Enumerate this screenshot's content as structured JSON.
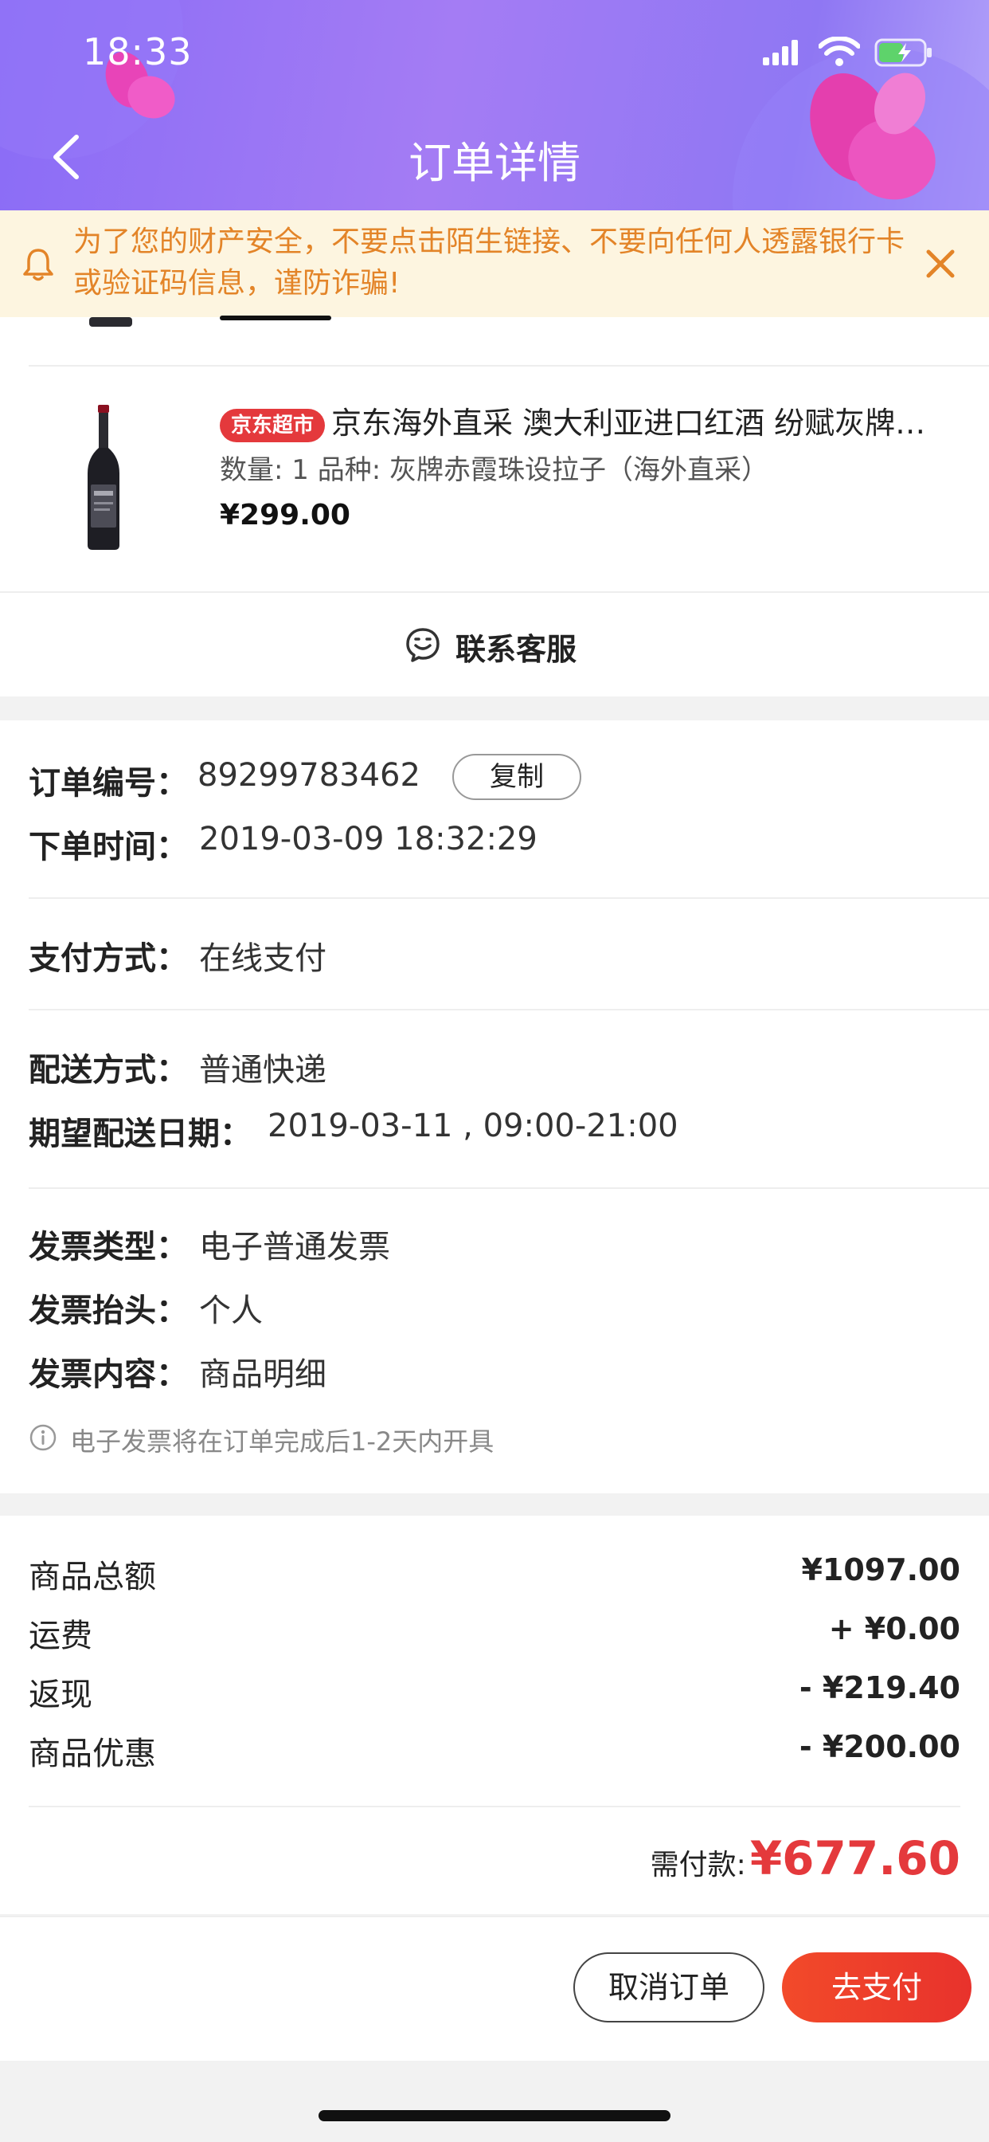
{
  "status_bar": {
    "time": "18:33"
  },
  "header": {
    "title": "订单详情"
  },
  "notice": {
    "text": "为了您的财产安全，不要点击陌生链接、不要向任何人透露银行卡或验证码信息，谨防诈骗!"
  },
  "products": [
    {
      "tag": "京东超市",
      "name": "京东海外直采 澳大利亚进口红酒 纷赋灰牌…",
      "spec": "数量: 1 品种: 灰牌赤霞珠设拉子（海外直采）",
      "price": "¥299.00"
    }
  ],
  "service": {
    "label": "联系客服"
  },
  "order": {
    "number_label": "订单编号：",
    "number": "89299783462",
    "copy_label": "复制",
    "time_label": "下单时间：",
    "time": "2019-03-09 18:32:29",
    "payment_label": "支付方式：",
    "payment": "在线支付",
    "delivery_label": "配送方式：",
    "delivery": "普通快递",
    "expected_label": "期望配送日期：",
    "expected": "2019-03-11 , 09:00-21:00",
    "invoice_type_label": "发票类型：",
    "invoice_type": "电子普通发票",
    "invoice_title_label": "发票抬头：",
    "invoice_title": "个人",
    "invoice_content_label": "发票内容：",
    "invoice_content": "商品明细",
    "invoice_hint": "电子发票将在订单完成后1-2天内开具"
  },
  "summary": {
    "rows": [
      {
        "label": "商品总额",
        "value": "¥1097.00"
      },
      {
        "label": "运费",
        "value": "+ ¥0.00"
      },
      {
        "label": "返现",
        "value": "- ¥219.40"
      },
      {
        "label": "商品优惠",
        "value": "- ¥200.00"
      }
    ],
    "need_pay_label": "需付款:",
    "need_pay": "¥677.60"
  },
  "actions": {
    "cancel": "取消订单",
    "pay": "去支付"
  },
  "colors": {
    "accent": "#e4393c",
    "header_purple": "#8a6cf6",
    "notice_text": "#e38428"
  }
}
